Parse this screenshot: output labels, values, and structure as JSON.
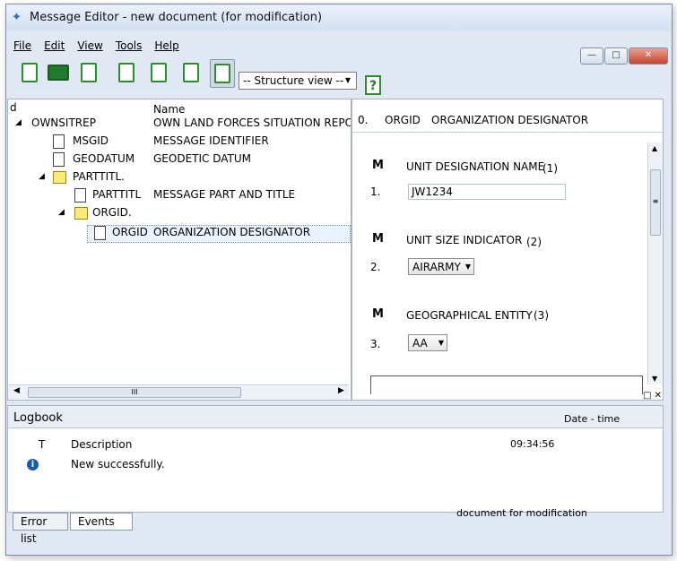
{
  "window": {
    "title": "Message Editor - new document (for modification)"
  },
  "menu": [
    "File",
    "Edit",
    "View",
    "Tools",
    "Help"
  ],
  "toolbar": {
    "structure_view": "-- Structure view --",
    "help": "?"
  },
  "tree": {
    "col_id": "d",
    "col_name": "Name",
    "rows": [
      {
        "id": "OWNSITREP",
        "name": "OWN LAND FORCES SITUATION REPORT"
      },
      {
        "id": "MSGID",
        "name": "MESSAGE IDENTIFIER"
      },
      {
        "id": "GEODATUM",
        "name": "GEODETIC DATUM"
      },
      {
        "id": "PARTTITL.",
        "name": ""
      },
      {
        "id": "PARTTITL",
        "name": "MESSAGE PART AND TITLE"
      },
      {
        "id": "ORGID.",
        "name": ""
      },
      {
        "id": "ORGID",
        "name": "ORGANIZATION DESIGNATOR"
      }
    ],
    "hscroll_mark": "III"
  },
  "editor": {
    "header_index": "0.",
    "header_id": "ORGID",
    "header_name": "ORGANIZATION DESIGNATOR",
    "fields": [
      {
        "flag": "M",
        "label": "UNIT DESIGNATION NAME",
        "num": "(1)",
        "idx": "1.",
        "value": "JW1234"
      },
      {
        "flag": "M",
        "label": "UNIT SIZE INDICATOR",
        "num": "(2)",
        "idx": "2.",
        "value": "AIRARMY"
      },
      {
        "flag": "M",
        "label": "GEOGRAPHICAL ENTITY",
        "num": "(3)",
        "idx": "3.",
        "value": "AA"
      }
    ],
    "vscroll_mark": "≡"
  },
  "logbook": {
    "title": "Logbook",
    "col_type": "T",
    "col_desc": "Description",
    "col_date": "Date - time",
    "entries": [
      {
        "desc": "New successfully.",
        "time": "09:34:56"
      }
    ]
  },
  "tabs": [
    "Error list",
    "Events"
  ],
  "status": "document for modification"
}
